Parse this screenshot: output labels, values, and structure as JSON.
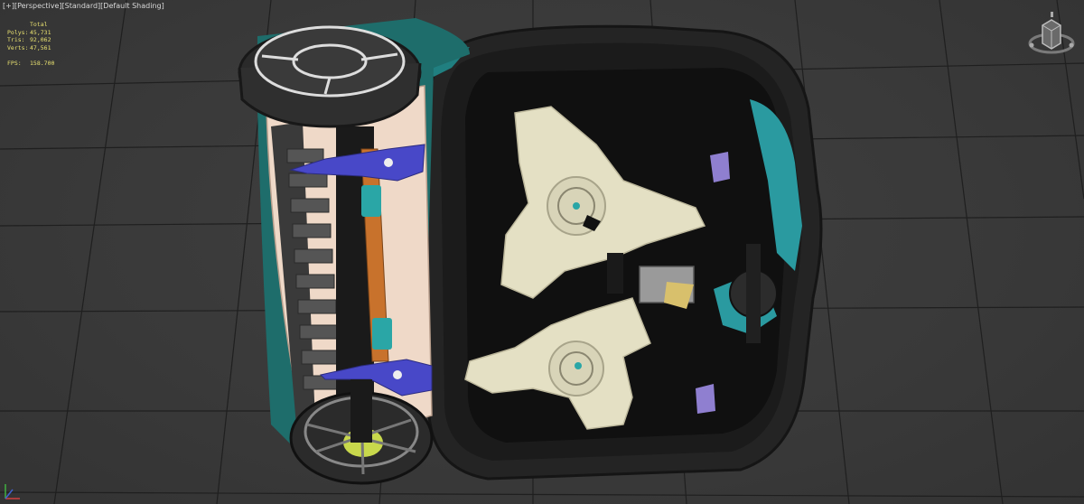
{
  "viewport": {
    "menu_plus": "[+]",
    "view_mode": "[Perspective]",
    "render_style": "[Standard]",
    "shading": "[Default Shading]"
  },
  "stats": {
    "header": "Total",
    "polys_label": "Polys:",
    "polys_value": "45,731",
    "tris_label": "Tris:",
    "tris_value": "92,062",
    "verts_label": "Verts:",
    "verts_value": "47,561",
    "fps_label": "FPS:",
    "fps_value": "158.700"
  },
  "icons": {
    "viewcube": "viewcube-icon",
    "axis_tripod": "axis-tripod-icon"
  },
  "colors": {
    "viewport_bg": "#3a3a3a",
    "grid": "#1e1e1e",
    "stats_text": "#e8e070",
    "label_text": "#d8d8d8",
    "teal_accent": "#2a9aa0",
    "blade_color": "#e4e0c4",
    "blue_bracket": "#4848c8",
    "wood_rod": "#c8722c"
  }
}
